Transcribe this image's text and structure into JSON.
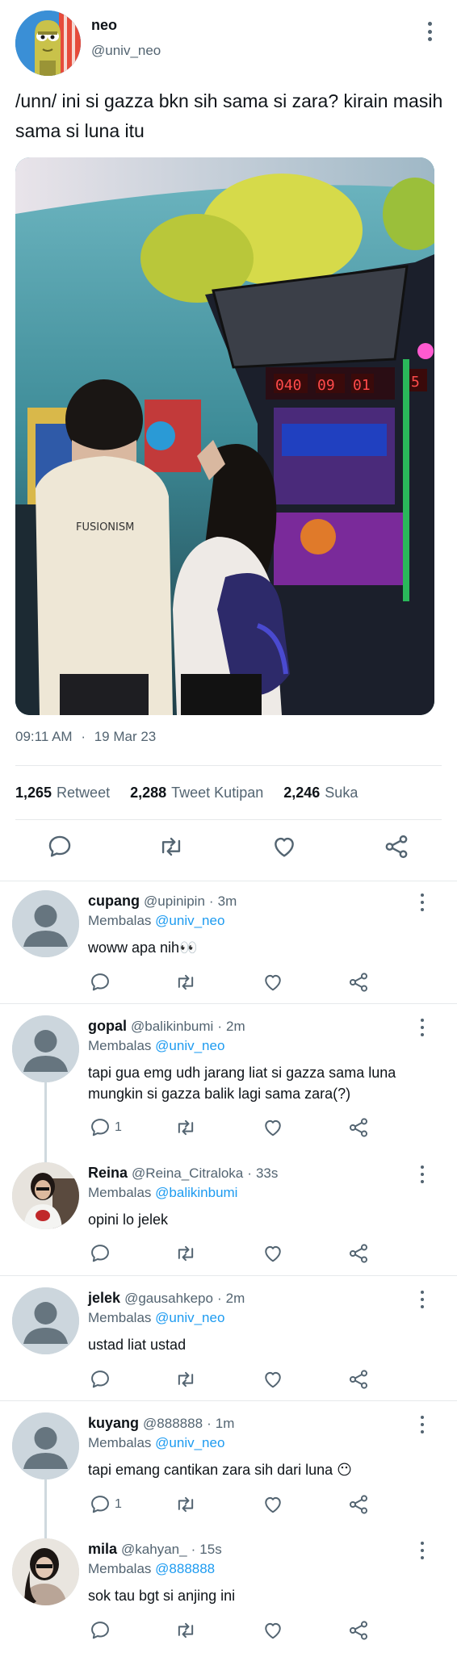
{
  "tweet": {
    "display_name": "neo",
    "handle": "@univ_neo",
    "text": "/unn/ ini si gazza bkn sih sama si zara? kirain masih sama si luna itu",
    "photo_caption": "FUSIONISM",
    "scoreboard": [
      "040",
      "09",
      "01",
      "5"
    ],
    "time": "09:11 AM",
    "date": "19 Mar 23",
    "stats": [
      {
        "value": "1,265",
        "label": "Retweet"
      },
      {
        "value": "2,288",
        "label": "Tweet Kutipan"
      },
      {
        "value": "2,246",
        "label": "Suka"
      }
    ]
  },
  "replies": [
    {
      "name": "cupang",
      "handle": "@upinipin",
      "time": "3m",
      "replying_label": "Membalas",
      "replying_to": "@univ_neo",
      "text": "woww apa nih👀",
      "reply_count": ""
    },
    {
      "name": "gopal",
      "handle": "@balikinbumi",
      "time": "2m",
      "replying_label": "Membalas",
      "replying_to": "@univ_neo",
      "text": "tapi gua emg udh jarang liat si gazza sama luna mungkin si gazza balik lagi sama zara(?)",
      "reply_count": "1"
    },
    {
      "name": "Reina",
      "handle": "@Reina_Citraloka",
      "time": "33s",
      "replying_label": "Membalas",
      "replying_to": "@balikinbumi",
      "text": "opini lo jelek",
      "reply_count": ""
    },
    {
      "name": "jelek",
      "handle": "@gausahkepo",
      "time": "2m",
      "replying_label": "Membalas",
      "replying_to": "@univ_neo",
      "text": "ustad liat ustad",
      "reply_count": ""
    },
    {
      "name": "kuyang",
      "handle": "@888888",
      "time": "1m",
      "replying_label": "Membalas",
      "replying_to": "@univ_neo",
      "text": "tapi emang cantikan zara sih dari luna 😶",
      "reply_count": "1"
    },
    {
      "name": "mila",
      "handle": "@kahyan_",
      "time": "15s",
      "replying_label": "Membalas",
      "replying_to": "@888888",
      "text": "sok tau bgt si anjing ini",
      "reply_count": ""
    }
  ],
  "icons": {
    "reply": "reply-icon",
    "retweet": "retweet-icon",
    "like": "heart-icon",
    "share": "share-icon",
    "more": "more-options-icon"
  },
  "colors": {
    "text": "#0f1419",
    "secondary": "#536471",
    "link": "#1d9bf0",
    "divider": "#e6e9eb"
  }
}
